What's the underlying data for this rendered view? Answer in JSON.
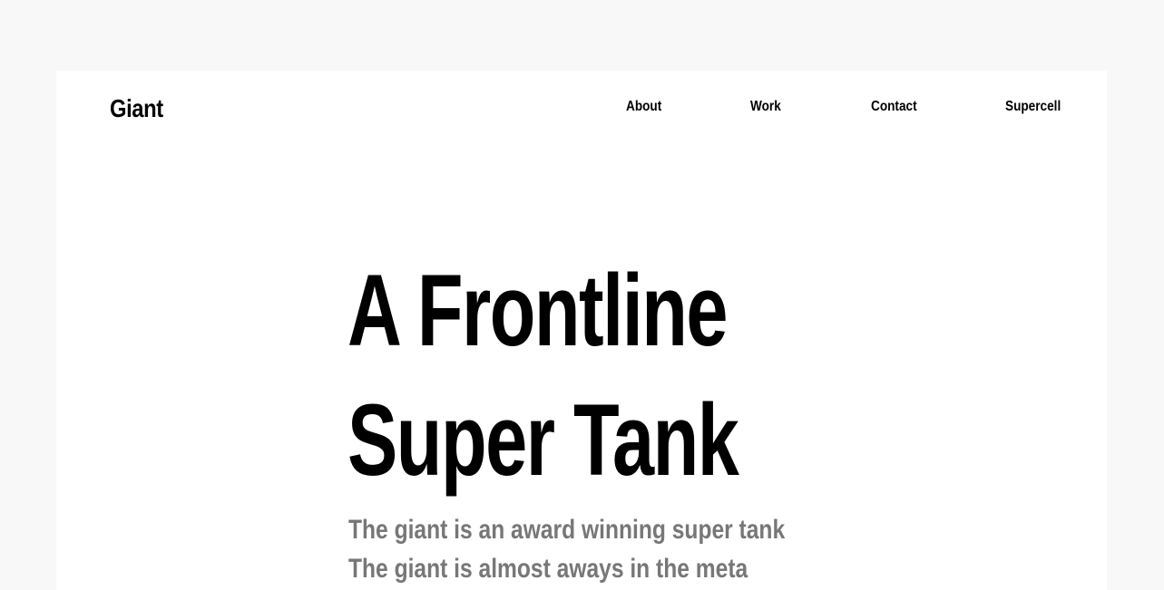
{
  "header": {
    "logo": "Giant",
    "nav": {
      "about": "About",
      "work": "Work",
      "contact": "Contact",
      "supercell": "Supercell"
    }
  },
  "hero": {
    "title_line1": "A Frontline",
    "title_line2": "Super Tank",
    "sub_line1": "The giant is an award winning super tank",
    "sub_line2": "The giant is almost aways in the meta"
  },
  "colors": {
    "page_background": "#f8f8f8",
    "card_background": "#ffffff",
    "text_primary": "#000000",
    "text_secondary": "#777777"
  }
}
